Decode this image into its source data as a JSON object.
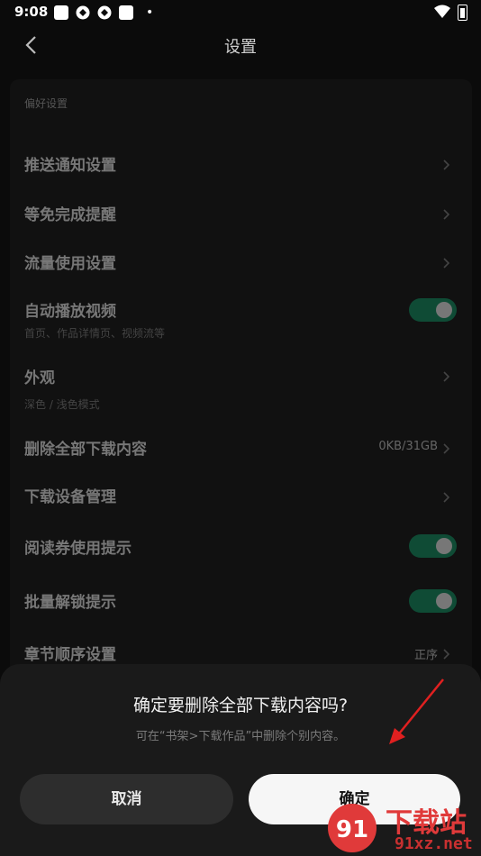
{
  "status_bar": {
    "time": "9:08",
    "dot": "•"
  },
  "header": {
    "title": "设置"
  },
  "settings": {
    "section_title": "偏好设置",
    "rows": [
      {
        "title": "推送通知设置"
      },
      {
        "title": "等免完成提醒"
      },
      {
        "title": "流量使用设置"
      },
      {
        "title": "自动播放视频",
        "subtitle": "首页、作品详情页、视频流等",
        "toggle": true
      },
      {
        "title": "外观",
        "subtitle": "深色 / 浅色模式"
      },
      {
        "title": "删除全部下载内容",
        "value": "0KB/31GB"
      },
      {
        "title": "下载设备管理"
      },
      {
        "title": "阅读券使用提示",
        "toggle": true
      },
      {
        "title": "批量解锁提示",
        "toggle": true
      },
      {
        "title": "章节顺序设置",
        "value": "正序"
      }
    ]
  },
  "dialog": {
    "title": "确定要删除全部下载内容吗?",
    "subtitle": "可在“书架>下载作品”中删除个别内容。",
    "cancel_label": "取消",
    "confirm_label": "确定"
  },
  "watermark": {
    "big_text": "下载站",
    "small_text": "91xz.net",
    "logo_text": "91"
  },
  "colors": {
    "toggle_on": "#0f4b35",
    "annotation_arrow": "#e02020",
    "watermark": "#e03a3a"
  }
}
